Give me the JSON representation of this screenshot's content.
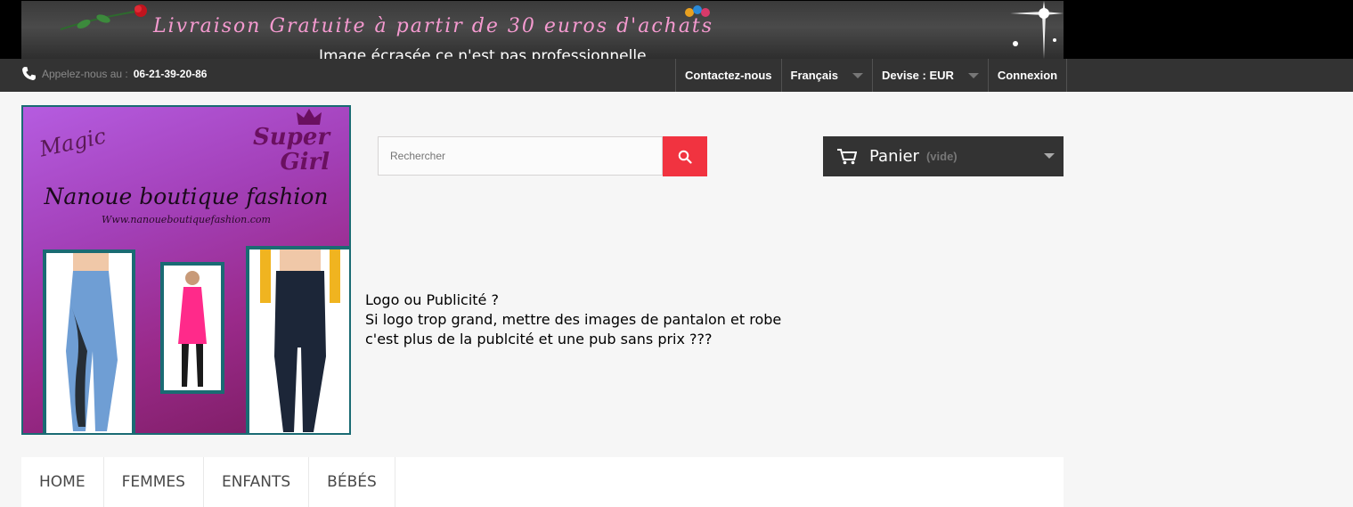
{
  "banner": {
    "text": "Livraison Gratuite à partir de 30 euros d'achats",
    "annotation": "Image écrasée ce n'est pas professionnelle"
  },
  "navbar": {
    "phone_label": "Appelez-nous au :",
    "phone_number": "06-21-39-20-86",
    "contact": "Contactez-nous",
    "language": "Français",
    "currency": "Devise : EUR",
    "login": "Connexion"
  },
  "logo": {
    "magic": "Magic",
    "super_line1": "Super",
    "super_line2": "Girl",
    "title": "Nanoue boutique fashion",
    "url": "Www.nanoueboutiquefashion.com"
  },
  "search": {
    "placeholder": "Rechercher"
  },
  "cart": {
    "label": "Panier",
    "status": "(vide)"
  },
  "annotation": {
    "line1": "Logo ou Publicité ?",
    "line2": "Si logo trop grand, mettre des images de pantalon et robe",
    "line3": "c'est plus de la publcité et une pub sans prix ???"
  },
  "menu": {
    "items": [
      {
        "label": "HOME"
      },
      {
        "label": "FEMMES"
      },
      {
        "label": "ENFANTS"
      },
      {
        "label": "BÉBÉS"
      }
    ]
  },
  "colors": {
    "accent_red": "#f13340",
    "dark_bar": "#333333",
    "banner_pink": "#f59ad0",
    "logo_purple": "#a340b8"
  }
}
